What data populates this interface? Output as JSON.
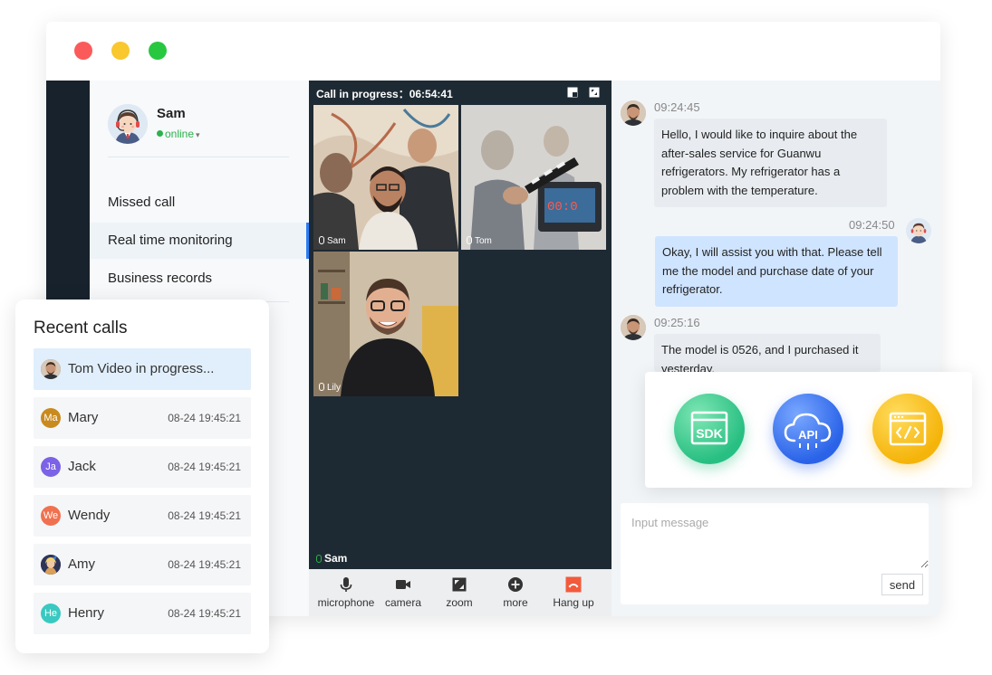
{
  "window": {
    "controls": [
      "close",
      "minimize",
      "maximize"
    ],
    "colors": {
      "close": "#fb5a5a",
      "minimize": "#f9c72e",
      "maximize": "#27c840"
    }
  },
  "profile": {
    "name": "Sam",
    "status": "online",
    "avatar_icon": "agent-headset-avatar"
  },
  "sidebar": {
    "items": [
      {
        "label": "Missed call"
      },
      {
        "label": "Real time monitoring",
        "active": true
      },
      {
        "label": "Business records"
      }
    ]
  },
  "video": {
    "header_label": "Call in progress：",
    "timer": "06:54:41",
    "participants": [
      {
        "name": "Sam"
      },
      {
        "name": "Tom"
      },
      {
        "name": "Lily"
      }
    ],
    "self_label": "Sam",
    "controls": [
      {
        "label": "microphone",
        "icon": "microphone-icon"
      },
      {
        "label": "camera",
        "icon": "camera-icon"
      },
      {
        "label": "zoom",
        "icon": "zoom-icon"
      },
      {
        "label": "more",
        "icon": "more-icon"
      },
      {
        "label": "Hang up",
        "icon": "hang-up-icon"
      }
    ],
    "hangup_color": "#f25a3b"
  },
  "chat": {
    "messages": [
      {
        "side": "left",
        "time": "09:24:45",
        "text": "Hello, I would like to inquire about the after-sales service for Guanwu refrigerators. My refrigerator has a problem with the temperature."
      },
      {
        "side": "right",
        "time": "09:24:50",
        "text": "Okay, I will assist you with that. Please tell me the model and purchase date of your refrigerator."
      },
      {
        "side": "left",
        "time": "09:25:16",
        "text": "The model is 0526, and I purchased it yesterday."
      }
    ],
    "input_placeholder": "Input message",
    "send_label": "send"
  },
  "integrations": [
    {
      "label": "SDK",
      "color": "#28bf82"
    },
    {
      "label": "API",
      "color": "#2a63e8"
    },
    {
      "label": "",
      "icon": "code-window-icon",
      "color": "#f5b40a"
    }
  ],
  "recent_calls": {
    "title": "Recent calls",
    "items": [
      {
        "name": "Tom Video in progress...",
        "time": "",
        "initials": "",
        "color": "#6b5a4e",
        "active": true
      },
      {
        "name": "Mary",
        "time": "08-24  19:45:21",
        "initials": "Ma",
        "color": "#c98a1e"
      },
      {
        "name": "Jack",
        "time": "08-24  19:45:21",
        "initials": "Ja",
        "color": "#7b62e6"
      },
      {
        "name": "Wendy",
        "time": "08-24  19:45:21",
        "initials": "We",
        "color": "#f0714f"
      },
      {
        "name": "Amy",
        "time": "08-24  19:45:21",
        "initials": "",
        "color": "#3b3f5c"
      },
      {
        "name": "Henry",
        "time": "08-24  19:45:21",
        "initials": "He",
        "color": "#39c9c0"
      }
    ]
  }
}
